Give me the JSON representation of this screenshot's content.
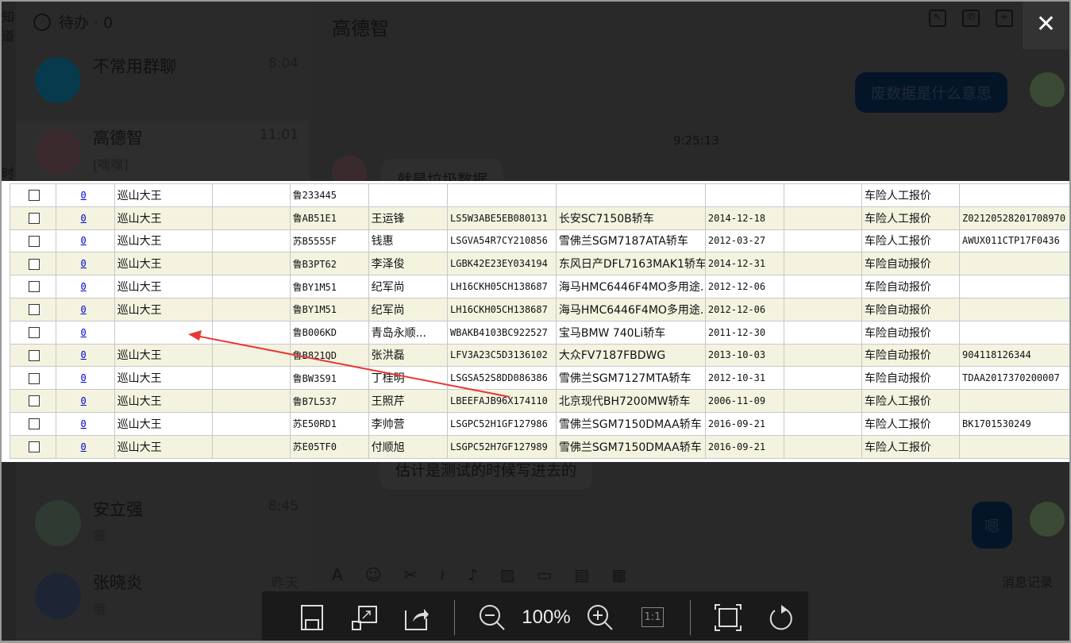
{
  "sidebar": {
    "todo_label": "待办 · 0",
    "edge_text": [
      "知道",
      "时"
    ],
    "conversations": [
      {
        "name": "不常用群聊",
        "time": "8:04",
        "preview": ""
      },
      {
        "name": "高德智",
        "time": "11:01",
        "preview": "[嘿嘿]"
      },
      {
        "name": "安立强",
        "time": "8:45",
        "preview": "嗯"
      },
      {
        "name": "张晓炎",
        "time": "昨天",
        "preview": "哦"
      }
    ],
    "partial_preview": "嗯"
  },
  "chat": {
    "title": "高德智",
    "messages": [
      {
        "from": "me",
        "text": "废数据是什么意思"
      },
      {
        "from": "timestamp",
        "text": "9:25:13"
      },
      {
        "from": "other",
        "text": "就是垃圾数据"
      },
      {
        "from": "other",
        "text": "估计是测试的时候写进去的"
      },
      {
        "from": "me",
        "text": "嗯"
      }
    ],
    "history_label": "消息记录"
  },
  "viewer": {
    "close_label": "✕",
    "zoom_level": "100%",
    "actual_size_label": "1:1",
    "table_rows": [
      [
        "0",
        "巡山大王",
        "",
        "鲁233445",
        "",
        "",
        "",
        "",
        "",
        "车险人工报价",
        ""
      ],
      [
        "0",
        "巡山大王",
        "",
        "鲁AB51E1",
        "王运锋",
        "LS5W3ABE5EB080131",
        "长安SC7150B轿车",
        "2014-12-18",
        "",
        "车险人工报价",
        "Z02120528201708970"
      ],
      [
        "0",
        "巡山大王",
        "",
        "苏B5555F",
        "钱惠",
        "LSGVA54R7CY210856",
        "雪佛兰SGM7187ATA轿车",
        "2012-03-27",
        "",
        "车险人工报价",
        "AWUX011CTP17F0436"
      ],
      [
        "0",
        "巡山大王",
        "",
        "鲁B3PT62",
        "李泽俊",
        "LGBK42E23EY034194",
        "东风日产DFL7163MAK1轿车",
        "2014-12-31",
        "",
        "车险自动报价",
        ""
      ],
      [
        "0",
        "巡山大王",
        "",
        "鲁BY1M51",
        "纪军尚",
        "LH16CKH05CH138687",
        "海马HMC6446F4MO多用途...",
        "2012-12-06",
        "",
        "车险自动报价",
        ""
      ],
      [
        "0",
        "巡山大王",
        "",
        "鲁BY1M51",
        "纪军尚",
        "LH16CKH05CH138687",
        "海马HMC6446F4MO多用途...",
        "2012-12-06",
        "",
        "车险自动报价",
        ""
      ],
      [
        "0",
        "",
        "",
        "鲁B006KD",
        "青岛永顺...",
        "WBAKB4103BC922527",
        "宝马BMW 740Li轿车",
        "2011-12-30",
        "",
        "车险自动报价",
        ""
      ],
      [
        "0",
        "巡山大王",
        "",
        "鲁B821QD",
        "张洪磊",
        "LFV3A23C5D3136102",
        "大众FV7187FBDWG",
        "2013-10-03",
        "",
        "车险自动报价",
        "904118126344"
      ],
      [
        "0",
        "巡山大王",
        "",
        "鲁BW3S91",
        "丁桂明",
        "LSGSA52S8DD086386",
        "雪佛兰SGM7127MTA轿车",
        "2012-10-31",
        "",
        "车险自动报价",
        "TDAA2017370200007"
      ],
      [
        "0",
        "巡山大王",
        "",
        "鲁B7L537",
        "王照芹",
        "LBEEFAJB96X174110",
        "北京现代BH7200MW轿车",
        "2006-11-09",
        "",
        "车险人工报价",
        ""
      ],
      [
        "0",
        "巡山大王",
        "",
        "苏E50RD1",
        "李帅营",
        "LSGPC52H1GF127986",
        "雪佛兰SGM7150DMAA轿车",
        "2016-09-21",
        "",
        "车险人工报价",
        "BK1701530249"
      ],
      [
        "0",
        "巡山大王",
        "",
        "苏E05TF0",
        "付顺旭",
        "LSGPC52H7GF127989",
        "雪佛兰SGM7150DMAA轿车",
        "2016-09-21",
        "",
        "车险人工报价",
        ""
      ]
    ],
    "annotation_color": "#e53935"
  }
}
